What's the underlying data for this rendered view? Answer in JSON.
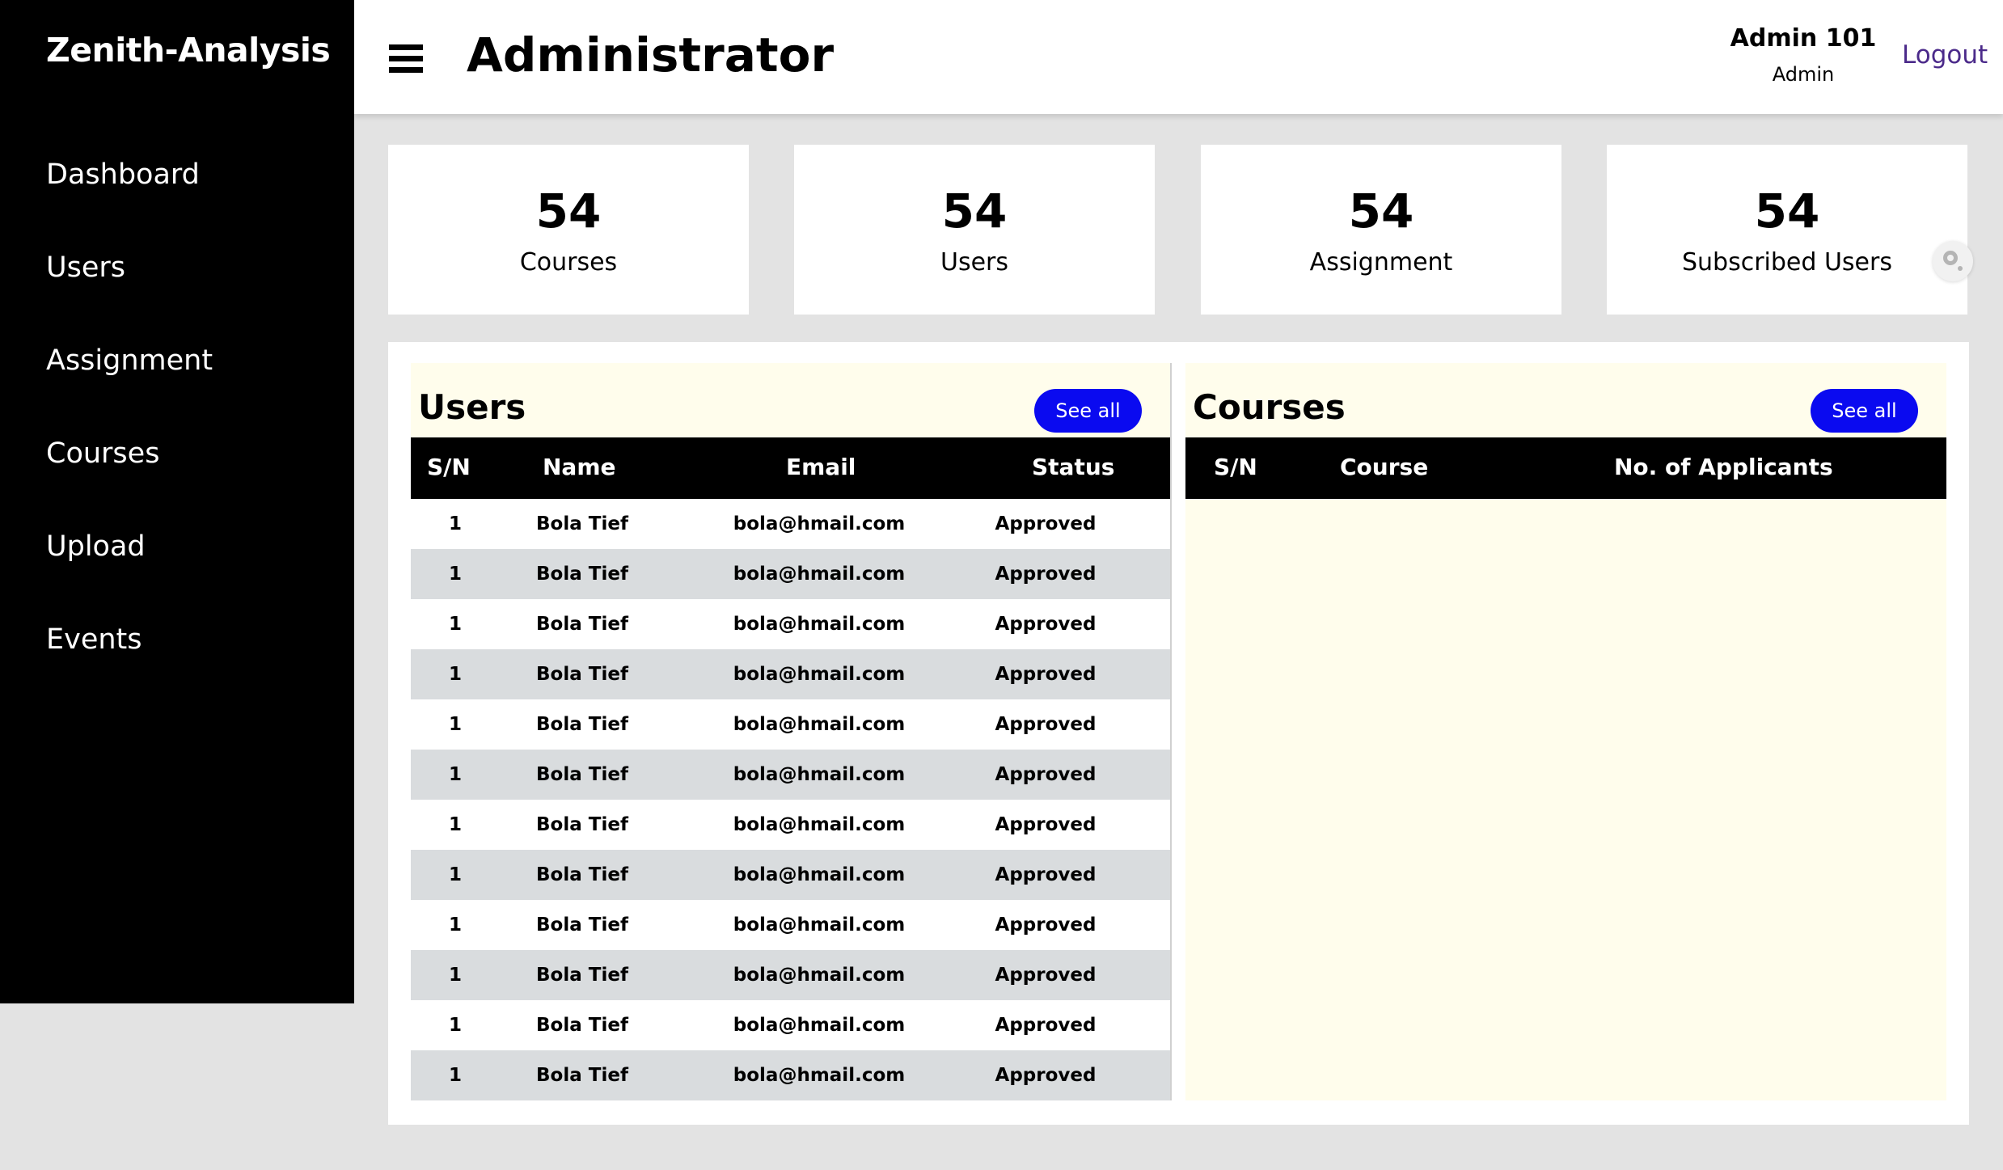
{
  "sidebar": {
    "brand": "Zenith-Analysis",
    "items": [
      {
        "label": "Dashboard"
      },
      {
        "label": "Users"
      },
      {
        "label": "Assignment"
      },
      {
        "label": "Courses"
      },
      {
        "label": "Upload"
      },
      {
        "label": "Events"
      }
    ]
  },
  "header": {
    "title": "Administrator",
    "user_name": "Admin 101",
    "user_role": "Admin",
    "logout_label": "Logout",
    "menu_icon": "hamburger-menu-icon"
  },
  "stats": [
    {
      "value": "54",
      "label": "Courses"
    },
    {
      "value": "54",
      "label": "Users"
    },
    {
      "value": "54",
      "label": "Assignment"
    },
    {
      "value": "54",
      "label": "Subscribed Users"
    }
  ],
  "users_panel": {
    "title": "Users",
    "see_all_label": "See all",
    "columns": [
      "S/N",
      "Name",
      "Email",
      "Status"
    ],
    "rows": [
      {
        "sn": "1",
        "name": "Bola Tief",
        "email": "bola@hmail.com",
        "status": "Approved"
      },
      {
        "sn": "1",
        "name": "Bola Tief",
        "email": "bola@hmail.com",
        "status": "Approved"
      },
      {
        "sn": "1",
        "name": "Bola Tief",
        "email": "bola@hmail.com",
        "status": "Approved"
      },
      {
        "sn": "1",
        "name": "Bola Tief",
        "email": "bola@hmail.com",
        "status": "Approved"
      },
      {
        "sn": "1",
        "name": "Bola Tief",
        "email": "bola@hmail.com",
        "status": "Approved"
      },
      {
        "sn": "1",
        "name": "Bola Tief",
        "email": "bola@hmail.com",
        "status": "Approved"
      },
      {
        "sn": "1",
        "name": "Bola Tief",
        "email": "bola@hmail.com",
        "status": "Approved"
      },
      {
        "sn": "1",
        "name": "Bola Tief",
        "email": "bola@hmail.com",
        "status": "Approved"
      },
      {
        "sn": "1",
        "name": "Bola Tief",
        "email": "bola@hmail.com",
        "status": "Approved"
      },
      {
        "sn": "1",
        "name": "Bola Tief",
        "email": "bola@hmail.com",
        "status": "Approved"
      },
      {
        "sn": "1",
        "name": "Bola Tief",
        "email": "bola@hmail.com",
        "status": "Approved"
      },
      {
        "sn": "1",
        "name": "Bola Tief",
        "email": "bola@hmail.com",
        "status": "Approved"
      }
    ]
  },
  "courses_panel": {
    "title": "Courses",
    "see_all_label": "See all",
    "columns": [
      "S/N",
      "Course",
      "No. of Applicants"
    ],
    "rows": []
  },
  "colors": {
    "sidebar_bg": "#000000",
    "accent_button": "#0a0af0",
    "logout_link": "#4b2a8a",
    "panel_header_bg": "#fffdec",
    "row_alt_bg": "#d9dcde"
  }
}
